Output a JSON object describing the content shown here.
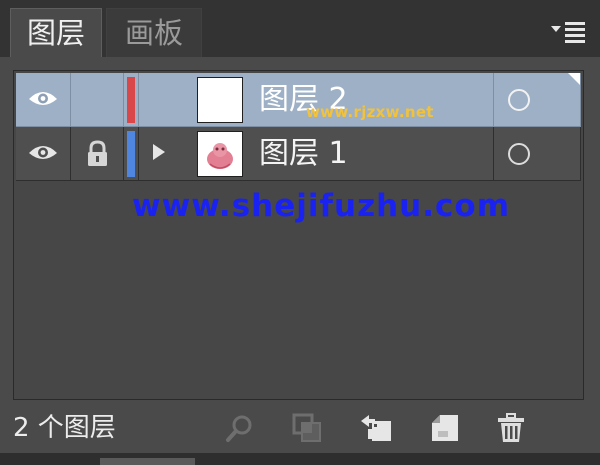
{
  "tabs": [
    {
      "label": "图层",
      "active": true
    },
    {
      "label": "画板",
      "active": false
    }
  ],
  "panel_menu_icon": "panel-menu-icon",
  "layers": [
    {
      "name": "图层 2",
      "visible": true,
      "locked": false,
      "color": "#d9474a",
      "selected": true,
      "has_children": false
    },
    {
      "name": "图层 1",
      "visible": true,
      "locked": true,
      "color": "#4f86e0",
      "selected": false,
      "has_children": true
    }
  ],
  "footer": {
    "layer_count": "2 个图层",
    "tools": [
      "search-icon",
      "clipping-mask-icon",
      "sublayer-icon",
      "new-layer-icon",
      "trash-icon"
    ]
  },
  "watermarks": {
    "small": "www.rjzxw.net",
    "big": "www.shejifuzhu.com"
  },
  "colors": {
    "selected_row": "#9eb0c5",
    "panel_bg": "#4a4a4a"
  }
}
